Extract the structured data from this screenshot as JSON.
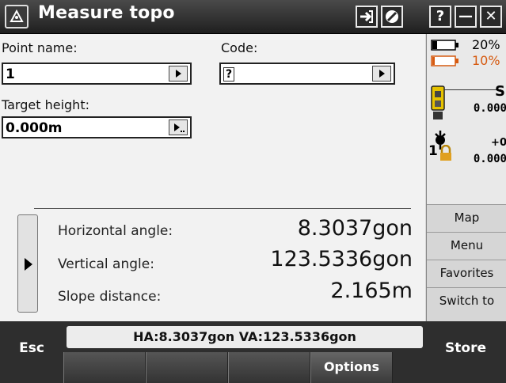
{
  "app": {
    "title": "Measure topo"
  },
  "window_controls": [
    "?",
    "—",
    "✕"
  ],
  "fields": {
    "point_name": {
      "label": "Point name:",
      "value": "1"
    },
    "code": {
      "label": "Code:",
      "value": "?"
    },
    "target_height": {
      "label": "Target height:",
      "value": "0.000m"
    }
  },
  "status_panel": {
    "battery1": "20%",
    "battery2": "10%",
    "s_label": "S",
    "value1": "0.000",
    "plus_label": "+0",
    "target_num": "1",
    "value2": "0.000"
  },
  "measurements": [
    {
      "label": "Horizontal angle:",
      "value": "8.3037gon"
    },
    {
      "label": "Vertical angle:",
      "value": "123.5336gon"
    },
    {
      "label": "Slope distance:",
      "value": "2.165m"
    }
  ],
  "side_buttons": [
    "Map",
    "Menu",
    "Favorites",
    "Switch to"
  ],
  "bottom": {
    "esc": "Esc",
    "store": "Store",
    "status_text": "HA:8.3037gon  VA:123.5336gon",
    "options": "Options"
  }
}
